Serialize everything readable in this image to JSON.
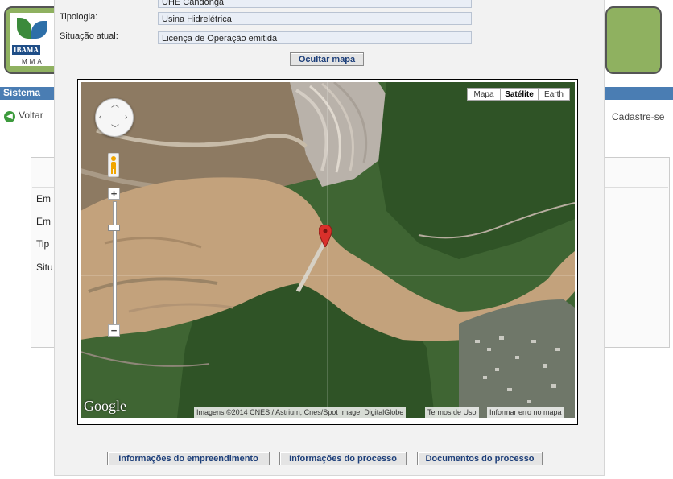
{
  "background": {
    "logo_text": "IBAMA",
    "logo_sub": "MMA",
    "bar_title": "Sistema",
    "back_link": "Voltar",
    "register_link": "Cadastre-se",
    "labels": [
      "Em",
      "Em",
      "Tip",
      "Situ"
    ]
  },
  "modal": {
    "fields": [
      {
        "label": "",
        "value": "UHE Candonga"
      },
      {
        "label": "Tipologia:",
        "value": "Usina Hidrelétrica"
      },
      {
        "label": "Situação atual:",
        "value": "Licença de Operação emitida"
      }
    ],
    "hide_map_button": "Ocultar mapa",
    "footer_buttons": [
      "Informações do empreendimento",
      "Informações do processo",
      "Documentos do processo"
    ]
  },
  "map": {
    "types": [
      "Mapa",
      "Satélite",
      "Earth"
    ],
    "active_type": "Satélite",
    "zoom_in": "+",
    "zoom_out": "−",
    "logo": "Google",
    "attribution": "Imagens ©2014 CNES / Astrium, Cnes/Spot Image, DigitalGlobe",
    "terms": "Termos de Uso",
    "report": "Informar erro no mapa",
    "colors": {
      "river": "#c3a27c",
      "forest": "#355a2a",
      "mine": "#b9b2aa",
      "marker": "#d9302b"
    }
  }
}
